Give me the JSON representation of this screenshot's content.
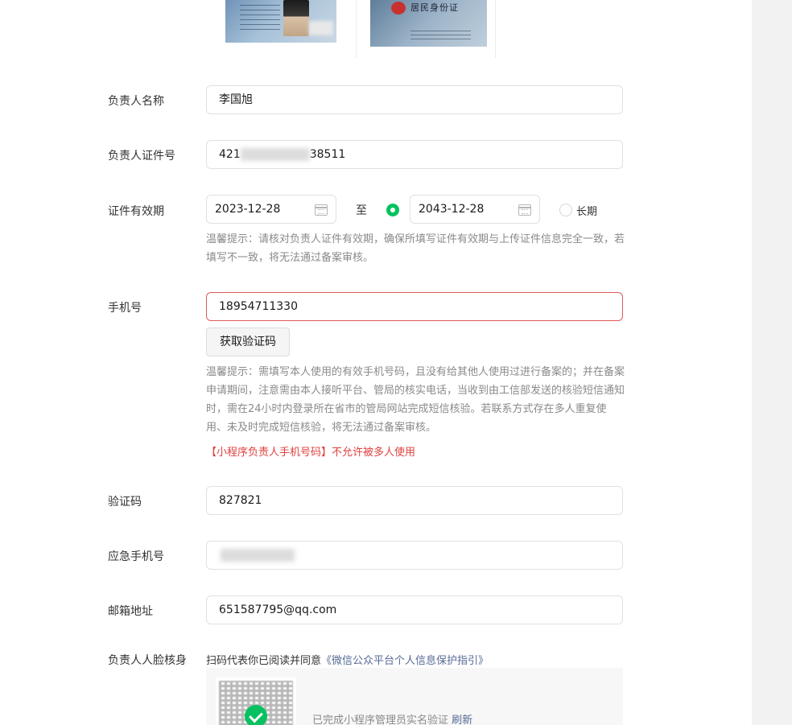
{
  "id_card": {
    "front_alt": "身份证人像面",
    "back_title": "居民身份证"
  },
  "form": {
    "principal_name": {
      "label": "负责人名称",
      "value": "李国旭"
    },
    "principal_id": {
      "label": "负责人证件号",
      "value_prefix": "421",
      "value_suffix": "38511"
    },
    "validity": {
      "label": "证件有效期",
      "start": "2023-12-28",
      "separator": "至",
      "end": "2043-12-28",
      "long_term_label": "长期",
      "tip": "温馨提示：请核对负责人证件有效期，确保所填写证件有效期与上传证件信息完全一致，若填写不一致，将无法通过备案审核。"
    },
    "phone": {
      "label": "手机号",
      "value": "18954711330",
      "get_code_button": "获取验证码",
      "tip": "温馨提示：需填写本人使用的有效手机号码，且没有给其他人使用过进行备案的；并在备案申请期间，注意需由本人接听平台、管局的核实电话，当收到由工信部发送的核验短信通知时，需在24小时内登录所在省市的管局网站完成短信核验。若联系方式存在多人重复使用、未及时完成短信核验，将无法通过备案审核。",
      "warning": "【小程序负责人手机号码】不允许被多人使用"
    },
    "verify_code": {
      "label": "验证码",
      "value": "827821"
    },
    "emergency_phone": {
      "label": "应急手机号"
    },
    "email": {
      "label": "邮箱地址",
      "value": "651587795@qq.com"
    },
    "face_verify": {
      "label": "负责人人脸核身",
      "consent_prefix": "扫码代表你已阅读并同意",
      "consent_link": "《微信公众平台个人信息保护指引》",
      "status_text": "已完成小程序管理员实名验证",
      "refresh_link": "刷新"
    }
  },
  "colors": {
    "accent_green": "#07c160",
    "link_blue": "#576b95",
    "error_red": "#e0413e"
  }
}
